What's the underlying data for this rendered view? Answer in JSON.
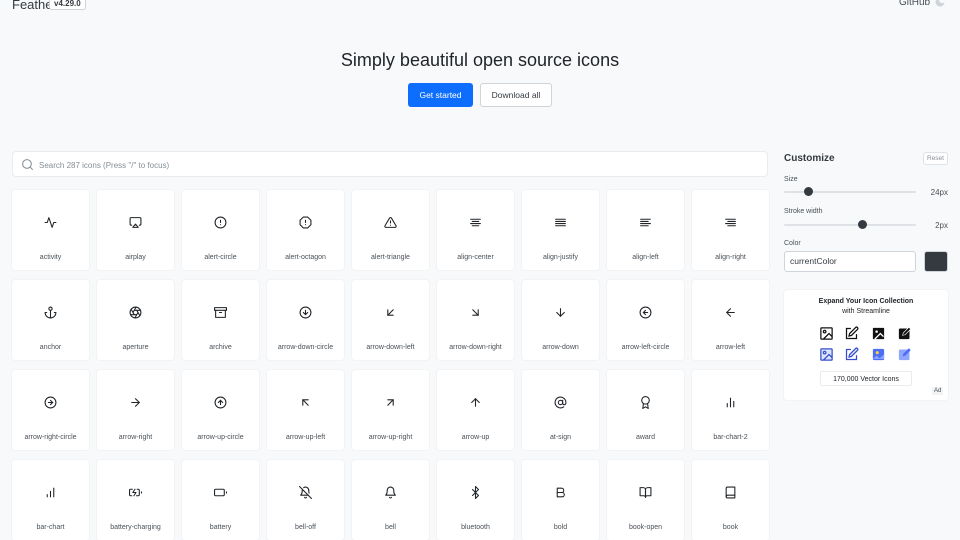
{
  "header": {
    "brand": "Feather",
    "version": "v4.29.0",
    "github": "GitHub"
  },
  "hero": {
    "title": "Simply beautiful open source icons",
    "primary_button": "Get started",
    "secondary_button": "Download all"
  },
  "search": {
    "placeholder": "Search 287 icons (Press \"/\" to focus)"
  },
  "icons": [
    "activity",
    "airplay",
    "alert-circle",
    "alert-octagon",
    "alert-triangle",
    "align-center",
    "align-justify",
    "align-left",
    "align-right",
    "anchor",
    "aperture",
    "archive",
    "arrow-down-circle",
    "arrow-down-left",
    "arrow-down-right",
    "arrow-down",
    "arrow-left-circle",
    "arrow-left",
    "arrow-right-circle",
    "arrow-right",
    "arrow-up-circle",
    "arrow-up-left",
    "arrow-up-right",
    "arrow-up",
    "at-sign",
    "award",
    "bar-chart-2",
    "bar-chart",
    "battery-charging",
    "battery",
    "bell-off",
    "bell",
    "bluetooth",
    "bold",
    "book-open",
    "book"
  ],
  "customize": {
    "title": "Customize",
    "reset": "Reset",
    "size_label": "Size",
    "size_value": "24px",
    "size_fraction": 0.16,
    "stroke_label": "Stroke width",
    "stroke_value": "2px",
    "stroke_fraction": 0.6,
    "color_label": "Color",
    "color_value": "currentColor",
    "color_hex": "#343a40"
  },
  "ad": {
    "title": "Expand Your Icon Collection",
    "subtitle": "with Streamline",
    "button": "170,000 Vector Icons",
    "tag": "Ad"
  },
  "colors": {
    "primary": "#0d6efd",
    "background": "#f8f9fa",
    "ad_accent": "#4c6ef5"
  }
}
